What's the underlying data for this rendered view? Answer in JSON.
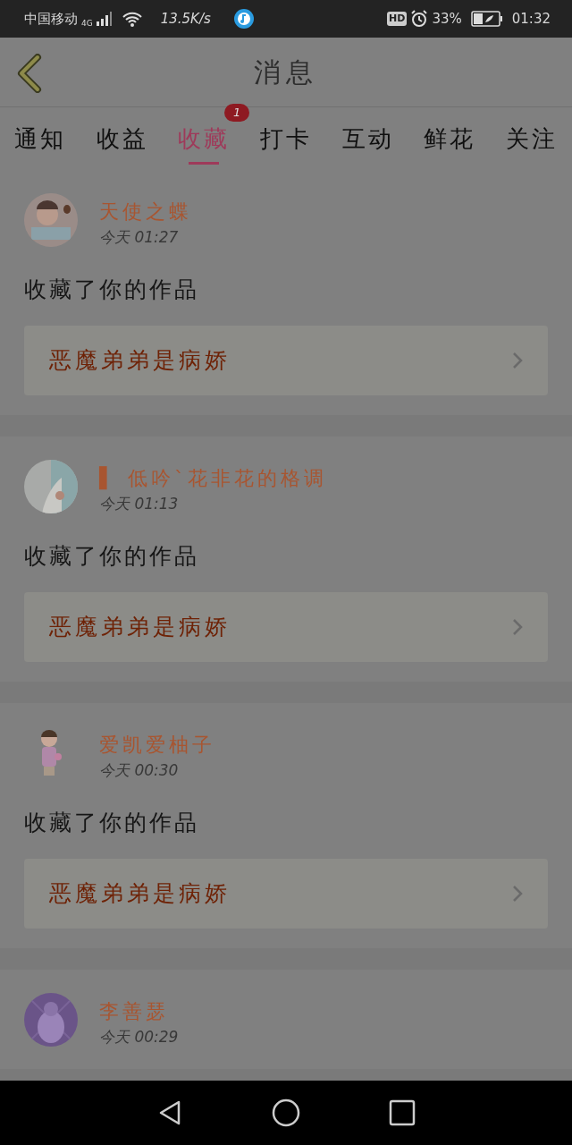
{
  "status_bar": {
    "carrier": "中国移动",
    "network": "4G",
    "speed": "13.5K/s",
    "hd": "HD",
    "battery": "33%",
    "time": "01:32"
  },
  "header": {
    "title": "消息"
  },
  "tabs": [
    {
      "label": "通知",
      "selected": false
    },
    {
      "label": "收益",
      "selected": false
    },
    {
      "label": "收藏",
      "selected": true,
      "badge": "1"
    },
    {
      "label": "打卡",
      "selected": false
    },
    {
      "label": "互动",
      "selected": false
    },
    {
      "label": "鲜花",
      "selected": false
    },
    {
      "label": "关注",
      "selected": false
    }
  ],
  "messages": [
    {
      "user": "天使之蝶",
      "time": "今天  01:27",
      "action": "收藏了你的作品",
      "work": "恶魔弟弟是病娇"
    },
    {
      "user": "▌ 低吟ˋ花非花的格调",
      "time": "今天  01:13",
      "action": "收藏了你的作品",
      "work": "恶魔弟弟是病娇"
    },
    {
      "user": "爱凯爱柚子",
      "time": "今天  00:30",
      "action": "收藏了你的作品",
      "work": "恶魔弟弟是病娇"
    },
    {
      "user": "李善瑟",
      "time": "今天  00:29"
    }
  ]
}
